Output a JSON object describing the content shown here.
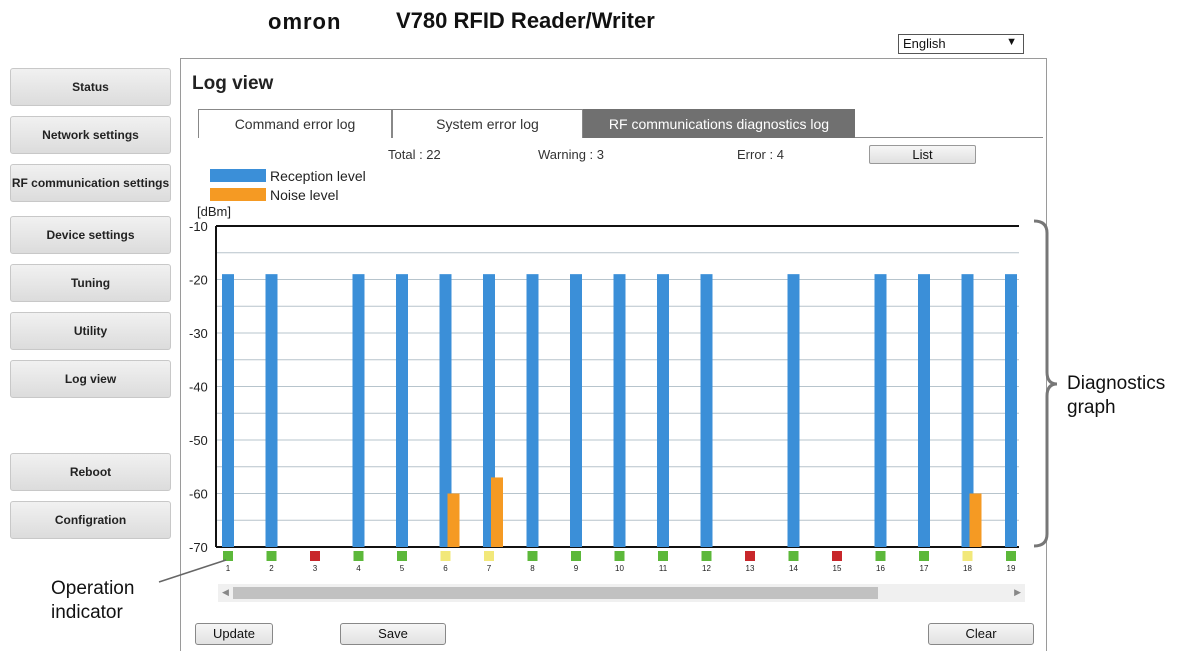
{
  "header": {
    "logo": "omron",
    "title": "V780 RFID Reader/Writer",
    "language": "English"
  },
  "sidebar": {
    "items": [
      {
        "label": "Status"
      },
      {
        "label": "Network settings"
      },
      {
        "label": "RF communication settings"
      },
      {
        "label": "Device settings"
      },
      {
        "label": "Tuning"
      },
      {
        "label": "Utility"
      },
      {
        "label": "Log view"
      },
      {
        "label": "Reboot"
      },
      {
        "label": "Configration"
      }
    ]
  },
  "main": {
    "title": "Log view",
    "tabs": [
      {
        "label": "Command error log",
        "active": false
      },
      {
        "label": "System error log",
        "active": false
      },
      {
        "label": "RF communications diagnostics log",
        "active": true
      }
    ],
    "stats": {
      "total": "Total : 22",
      "warning": "Warning : 3",
      "error": "Error : 4"
    },
    "list_button": "List",
    "buttons": {
      "update": "Update",
      "save": "Save",
      "clear": "Clear"
    }
  },
  "chart_data": {
    "type": "bar",
    "ylabel": "[dBm]",
    "ylim": [
      -70,
      -10
    ],
    "yticks": [
      -10,
      -20,
      -30,
      -40,
      -50,
      -60,
      -70
    ],
    "grid": true,
    "legend_placement": "top-left",
    "categories": [
      "1",
      "2",
      "3",
      "4",
      "5",
      "6",
      "7",
      "8",
      "9",
      "10",
      "11",
      "12",
      "13",
      "14",
      "15",
      "16",
      "17",
      "18",
      "19"
    ],
    "series": [
      {
        "name": "Reception level",
        "color": "#3b8fd8",
        "values": [
          -19,
          -19,
          null,
          -19,
          -19,
          -19,
          -19,
          -19,
          -19,
          -19,
          -19,
          -19,
          null,
          -19,
          null,
          -19,
          -19,
          -19,
          -19
        ]
      },
      {
        "name": "Noise level",
        "color": "#f59a23",
        "values": [
          null,
          null,
          null,
          null,
          null,
          -60,
          -57,
          null,
          null,
          null,
          null,
          null,
          null,
          null,
          null,
          null,
          null,
          -60,
          null
        ]
      }
    ],
    "indicators": [
      "ok",
      "ok",
      "error",
      "ok",
      "ok",
      "warning",
      "warning",
      "ok",
      "ok",
      "ok",
      "ok",
      "ok",
      "error",
      "ok",
      "error",
      "ok",
      "ok",
      "warning",
      "ok"
    ],
    "indicator_colors": {
      "ok": "#5cb83a",
      "warning": "#f2e87a",
      "error": "#c8272b"
    }
  },
  "annotations": {
    "diagnostics_graph": [
      "Diagnostics",
      "graph"
    ],
    "operation_indicator": [
      "Operation",
      "indicator"
    ]
  }
}
